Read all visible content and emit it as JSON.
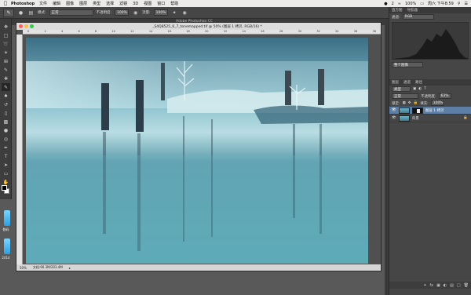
{
  "menubar": {
    "apple": "",
    "app_name": "Photoshop",
    "items": [
      "文件",
      "编辑",
      "图像",
      "图层",
      "类型",
      "选择",
      "滤镜",
      "3D",
      "视图",
      "窗口",
      "帮助"
    ],
    "badge": "2",
    "battery": "100%",
    "clock": "周六 下午8:59"
  },
  "options": {
    "mode_label": "模式:",
    "mode_value": "正常",
    "opacity_label": "不透明度:",
    "opacity_value": "100%",
    "flow_label": "流量:",
    "flow_value": "100%"
  },
  "app_title": "Adobe Photoshop CC",
  "document": {
    "title": "_S4Q8525_6_7_tonemapped.tif @ 50% (图层 1 拷贝, RGB/16) *",
    "ruler_ticks": [
      "0",
      "2",
      "4",
      "6",
      "8",
      "10",
      "12",
      "14",
      "16",
      "18",
      "20",
      "22",
      "24",
      "26",
      "28",
      "30",
      "32",
      "34",
      "36",
      "38"
    ],
    "zoom": "50%",
    "doc_info": "文档:90.3M/203.4M"
  },
  "panels": {
    "top_tabs": [
      "直方图",
      "导航器"
    ],
    "channel_label": "通道:",
    "channel_value": "RGB",
    "cache_label": "整个图像",
    "layer_tabs": [
      "图层",
      "通道",
      "路径"
    ],
    "filter_kind": "类型",
    "blend_mode": "正常",
    "opacity_label": "不透明度:",
    "opacity_value": "63%",
    "lock_label": "锁定:",
    "fill_label": "填充:",
    "fill_value": "100%",
    "layers": [
      {
        "name": "图层 1 拷贝",
        "active": true,
        "has_mask": true
      },
      {
        "name": "背景",
        "active": false,
        "has_mask": false
      }
    ]
  },
  "desktop": {
    "icons": [
      {
        "label": "数码"
      },
      {
        "label": "2014"
      }
    ]
  },
  "colors": {
    "fg_swatch": "#000000",
    "bg_swatch": "#ffffff",
    "selection_blue": "#5d7fa5"
  }
}
